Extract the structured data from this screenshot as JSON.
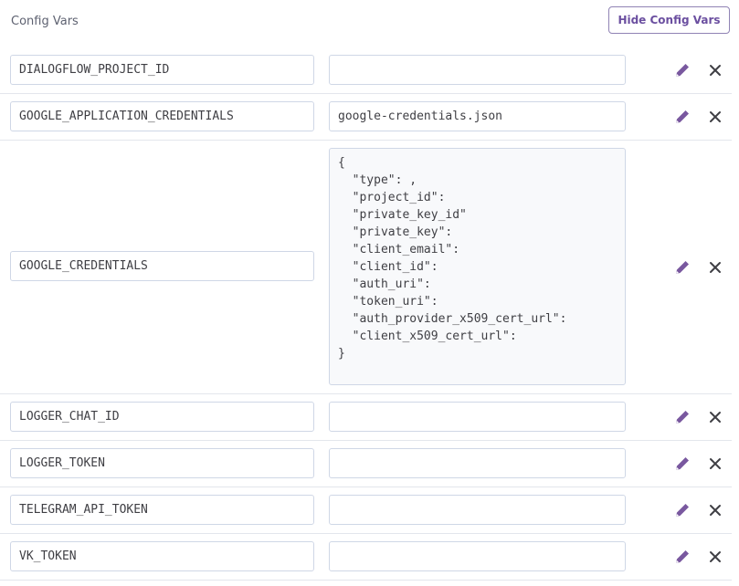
{
  "header": {
    "title": "Config Vars",
    "hide_button_label": "Hide Config Vars"
  },
  "config_vars": [
    {
      "key": "DIALOGFLOW_PROJECT_ID",
      "value": ""
    },
    {
      "key": "GOOGLE_APPLICATION_CREDENTIALS",
      "value": "google-credentials.json"
    },
    {
      "key": "GOOGLE_CREDENTIALS",
      "value": "{\n  \"type\": ,\n  \"project_id\":\n  \"private_key_id\"\n  \"private_key\":\n  \"client_email\":\n  \"client_id\":\n  \"auth_uri\":\n  \"token_uri\":\n  \"auth_provider_x509_cert_url\":\n  \"client_x509_cert_url\":\n}"
    },
    {
      "key": "LOGGER_CHAT_ID",
      "value": ""
    },
    {
      "key": "LOGGER_TOKEN",
      "value": ""
    },
    {
      "key": "TELEGRAM_API_TOKEN",
      "value": ""
    },
    {
      "key": "VK_TOKEN",
      "value": ""
    }
  ],
  "icons": {
    "edit": "pencil-icon",
    "delete": "close-icon"
  },
  "colors": {
    "accent": "#79589f",
    "delete": "#3f3f44",
    "border": "#cfd7e6"
  }
}
